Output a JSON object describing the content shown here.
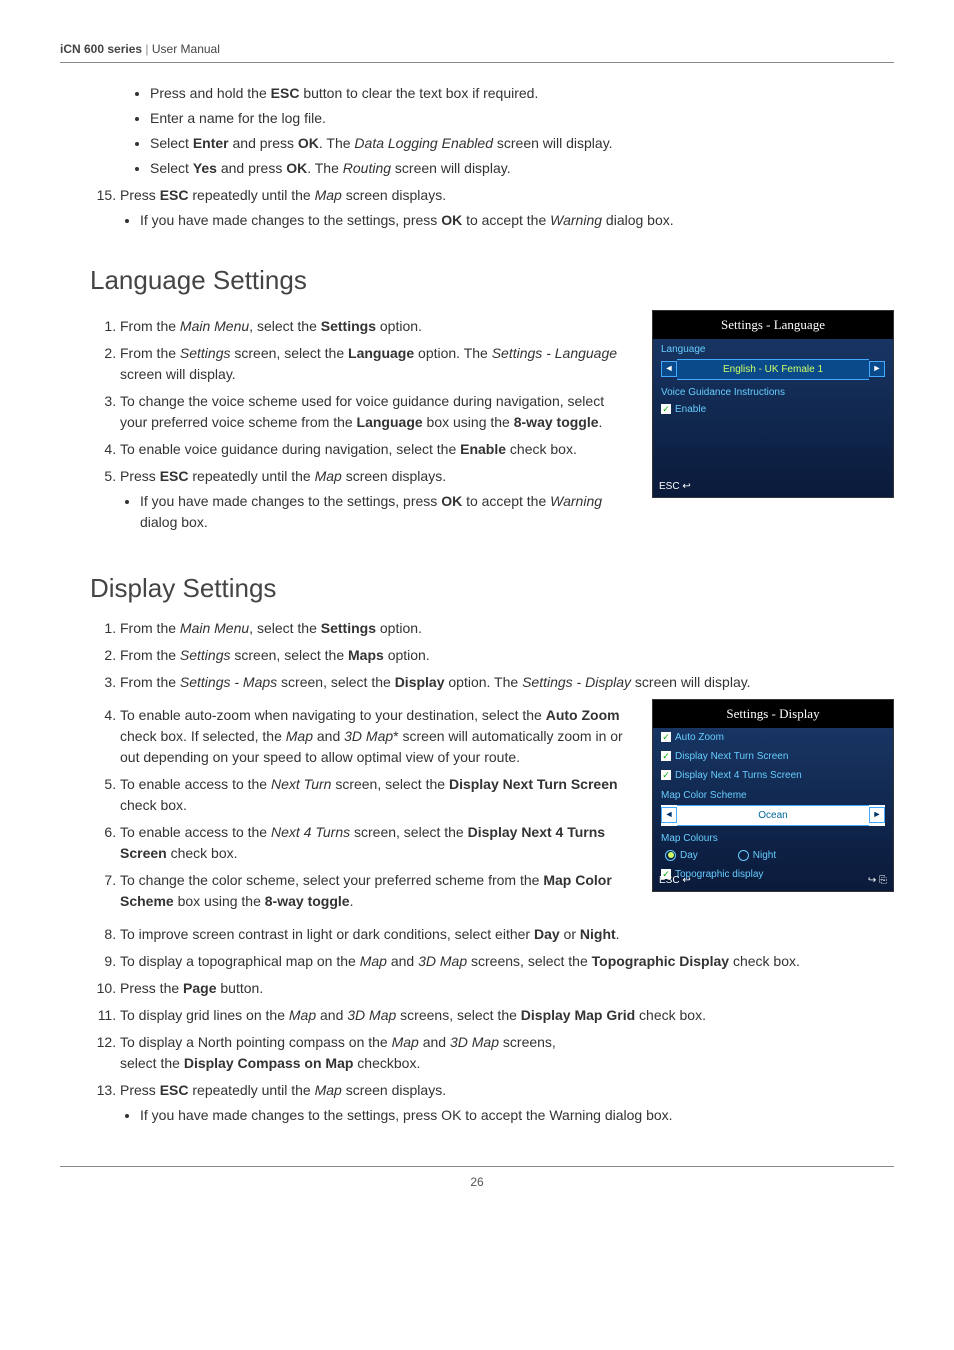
{
  "header": {
    "product": "iCN 600 series",
    "doc": "User Manual"
  },
  "topsteps": {
    "bullets": [
      "Press and hold the ESC button to clear the text box if required.",
      "Enter a name for the log file.",
      "Select Enter and press OK. The Data Logging Enabled screen will display.",
      "Select Yes and press OK. The Routing screen will display."
    ],
    "step15": "Press ESC repeatedly until the Map screen displays.",
    "step15sub": "If you have made changes to the settings, press OK to accept the Warning dialog box."
  },
  "lang": {
    "heading": "Language Settings",
    "s1": "From the Main Menu, select the Settings option.",
    "s2": "From the Settings screen, select the Language option. The Settings - Language screen will display.",
    "s3": "To change the voice scheme used for voice guidance during navigation, select your preferred voice scheme from the Language box using the 8-way toggle.",
    "s4": "To enable voice guidance during navigation, select the Enable check box.",
    "s5": "Press ESC repeatedly until the Map screen displays.",
    "s5sub": "If you have made changes to the settings, press OK to accept the Warning dialog box.",
    "shot": {
      "title": "Settings - Language",
      "field_label": "Language",
      "field_value": "English - UK Female 1",
      "vgi_label": "Voice Guidance Instructions",
      "enable": "Enable",
      "esc": "ESC ↩"
    }
  },
  "disp": {
    "heading": "Display Settings",
    "s1": "From the Main Menu, select the Settings option.",
    "s2": "From the Settings screen, select the Maps option.",
    "s3": "From the Settings - Maps screen, select the Display option. The Settings - Display screen will display.",
    "s4": "To enable auto-zoom when navigating to your destination, select the Auto Zoom check box. If selected, the Map and 3D Map* screen will automatically zoom in or out depending on your speed to allow optimal view of your route.",
    "s5": "To enable access to the Next Turn screen, select the Display Next Turn Screen check box.",
    "s6": "To enable access to the Next 4 Turns screen, select the Display Next 4 Turns Screen check box.",
    "s7": "To change the color scheme, select your preferred scheme from the Map Color Scheme box using the 8-way toggle.",
    "s8": "To improve screen contrast in light or dark conditions, select either Day or Night.",
    "s9": "To display a topographical map on the Map and 3D Map screens, select the Topographic Display check box.",
    "s10": "Press the Page button.",
    "s11": "To display grid lines on the Map and 3D Map screens, select the Display Map Grid check box.",
    "s12": "To display a North pointing compass on the Map and 3D Map screens, select the Display Compass on Map checkbox.",
    "s13": "Press ESC repeatedly until the Map screen displays.",
    "s13sub": "If you have made changes to the settings, press OK to accept the Warning dialog box.",
    "shot": {
      "title": "Settings - Display",
      "cb1": "Auto Zoom",
      "cb2": "Display Next Turn Screen",
      "cb3": "Display Next 4 Turns Screen",
      "mcs_label": "Map Color Scheme",
      "mcs_value": "Ocean",
      "mc_label": "Map Colours",
      "day": "Day",
      "night": "Night",
      "topo": "Topographic display",
      "esc": "ESC ↩"
    }
  },
  "page_number": "26"
}
